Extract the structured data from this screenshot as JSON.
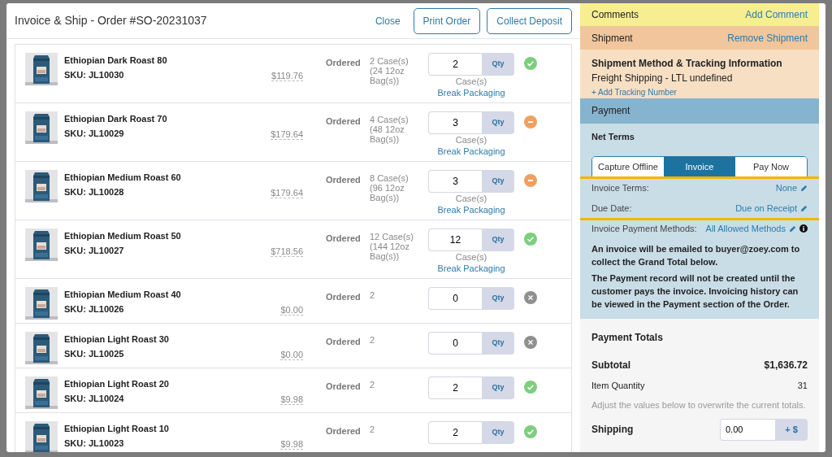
{
  "modal": {
    "title": "Invoice & Ship - Order #SO-20231037",
    "actions": [
      {
        "label": "Close",
        "kind": "link"
      },
      {
        "label": "Print Order",
        "kind": "outline"
      },
      {
        "label": "Collect Deposit",
        "kind": "outline"
      }
    ]
  },
  "line_items": [
    {
      "name": "Ethiopian Dark Roast 80",
      "sku": "SKU: JL10030",
      "price": "$119.76",
      "status": "Ordered",
      "ordered": "2 Case(s) (24 12oz Bag(s))",
      "qty": "2",
      "qty_label": "Qty",
      "unit": "Case(s)",
      "action": "Break Packaging",
      "kind": "full"
    },
    {
      "name": "Ethiopian Dark Roast 70",
      "sku": "SKU: JL10029",
      "price": "$179.64",
      "status": "Ordered",
      "ordered": "4 Case(s) (48 12oz Bag(s))",
      "qty": "3",
      "qty_label": "Qty",
      "unit": "Case(s)",
      "action": "Break Packaging",
      "kind": "partial"
    },
    {
      "name": "Ethiopian Medium Roast 60",
      "sku": "SKU: JL10028",
      "price": "$179.64",
      "status": "Ordered",
      "ordered": "8 Case(s) (96 12oz Bag(s))",
      "qty": "3",
      "qty_label": "Qty",
      "unit": "Case(s)",
      "action": "Break Packaging",
      "kind": "partial"
    },
    {
      "name": "Ethiopian Medium Roast 50",
      "sku": "SKU: JL10027",
      "price": "$718.56",
      "status": "Ordered",
      "ordered": "12 Case(s) (144 12oz Bag(s))",
      "qty": "12",
      "qty_label": "Qty",
      "unit": "Case(s)",
      "action": "Break Packaging",
      "kind": "full"
    },
    {
      "name": "Ethiopian Medium Roast 40",
      "sku": "SKU: JL10026",
      "price": "$0.00",
      "status": "Ordered",
      "ordered": "2",
      "qty": "0",
      "qty_label": "Qty",
      "kind": "none"
    },
    {
      "name": "Ethiopian Light Roast 30",
      "sku": "SKU: JL10025",
      "price": "$0.00",
      "status": "Ordered",
      "ordered": "2",
      "qty": "0",
      "qty_label": "Qty",
      "kind": "none"
    },
    {
      "name": "Ethiopian Light Roast 20",
      "sku": "SKU: JL10024",
      "price": "$9.98",
      "status": "Ordered",
      "ordered": "2",
      "qty": "2",
      "qty_label": "Qty",
      "kind": "full"
    },
    {
      "name": "Ethiopian Light Roast 10",
      "sku": "SKU: JL10023",
      "price": "$9.98",
      "status": "Ordered",
      "ordered": "2",
      "qty": "2",
      "qty_label": "Qty",
      "kind": "full"
    }
  ],
  "comments": {
    "title": "Comments",
    "action": "Add Comment"
  },
  "shipment": {
    "title": "Shipment",
    "action": "Remove Shipment",
    "method_heading": "Shipment Method & Tracking Information",
    "method": "Freight Shipping - LTL undefined",
    "tracking_link": "+ Add Tracking Number"
  },
  "payment": {
    "title": "Payment",
    "terms_heading": "Net Terms",
    "options": [
      {
        "label": "Capture Offline",
        "selected": false
      },
      {
        "label": "Invoice",
        "selected": true
      },
      {
        "label": "Pay Now",
        "selected": false
      }
    ],
    "fields": [
      {
        "label": "Invoice Terms:",
        "value": "None",
        "highlighted": true
      },
      {
        "label": "Due Date:",
        "value": "Due on Receipt",
        "highlighted": true
      },
      {
        "label": "Invoice Payment Methods:",
        "value": "All Allowed Methods",
        "highlighted": false,
        "info": true
      }
    ],
    "notes": [
      "An invoice will be emailed to buyer@zoey.com to collect the Grand Total below.",
      "The Payment record will not be created until the customer pays the invoice. Invoicing history can be viewed in the Payment section of the Order."
    ]
  },
  "totals": {
    "title": "Payment Totals",
    "rows": [
      {
        "label": "Subtotal",
        "value": "$1,636.72",
        "bold": true
      },
      {
        "label": "Item Quantity",
        "value": "31",
        "bold": false
      }
    ],
    "hint": "Adjust the values below to overwrite the current totals.",
    "shipping": {
      "label": "Shipping",
      "value": "0.00",
      "addon": "+ $"
    }
  }
}
